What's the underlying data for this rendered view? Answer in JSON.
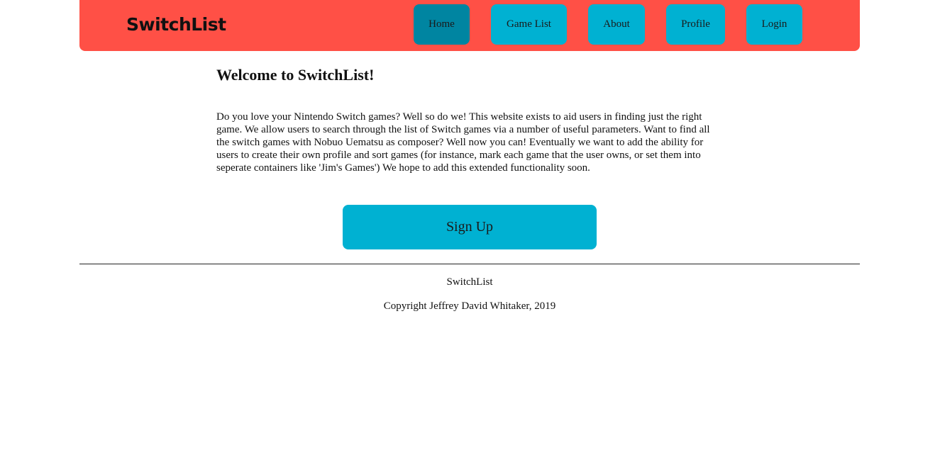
{
  "header": {
    "brand": "SwitchList",
    "colors": {
      "background": "#ff5046",
      "button": "#00b1d2",
      "button_active": "#0085a1"
    },
    "nav": [
      {
        "label": "Home",
        "active": true
      },
      {
        "label": "Game List",
        "active": false
      },
      {
        "label": "About",
        "active": false
      },
      {
        "label": "Profile",
        "active": false
      },
      {
        "label": "Login",
        "active": false
      }
    ]
  },
  "main": {
    "title": "Welcome to SwitchList!",
    "intro": "Do you love your Nintendo Switch games? Well so do we! This website exists to aid users in finding just the right game. We allow users to search through the list of Switch games via a number of useful parameters. Want to find all the switch games with Nobuo Uematsu as composer? Well now you can! Eventually we want to add the ability for users to create their own profile and sort games (for instance, mark each game that the user owns, or set them into seperate containers like 'Jim's Games') We hope to add this extended functionality soon.",
    "signup_label": "Sign Up"
  },
  "footer": {
    "name": "SwitchList",
    "copyright": "Copyright Jeffrey David Whitaker, 2019"
  }
}
